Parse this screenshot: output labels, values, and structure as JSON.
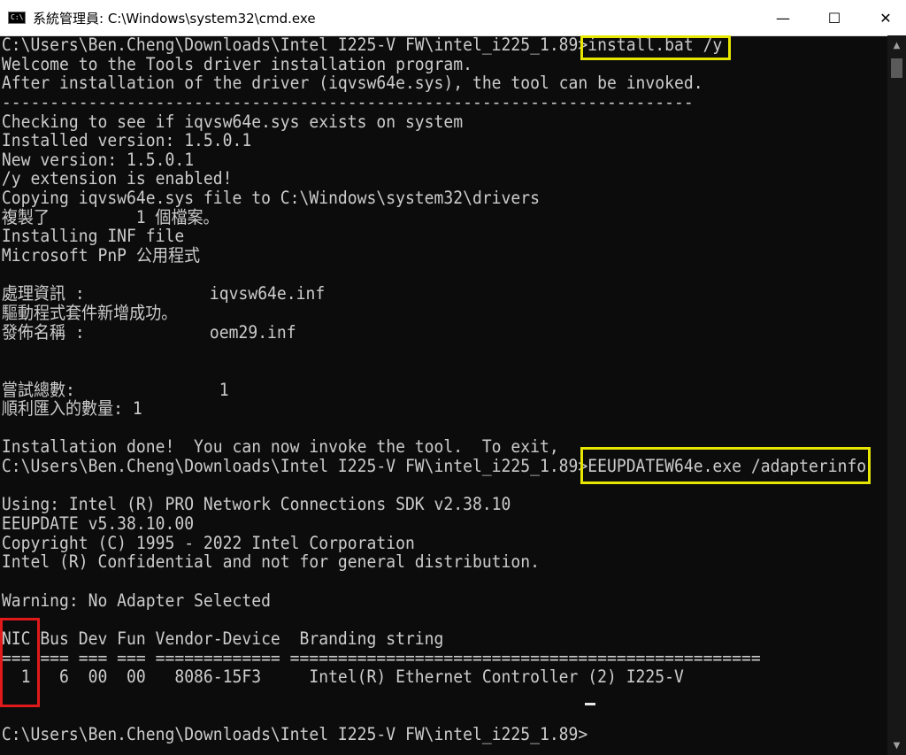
{
  "window": {
    "title": "系統管理員: C:\\Windows\\system32\\cmd.exe",
    "icon_text": "C:\\.",
    "minimize": "—",
    "maximize": "☐",
    "close": "✕"
  },
  "terminal": {
    "lines": [
      "C:\\Users\\Ben.Cheng\\Downloads\\Intel I225-V FW\\intel_i225_1.89>install.bat /y",
      "Welcome to the Tools driver installation program.",
      "After installation of the driver (iqvsw64e.sys), the tool can be invoked.",
      "------------------------------------------------------------------------",
      "Checking to see if iqvsw64e.sys exists on system",
      "Installed version: 1.5.0.1",
      "New version: 1.5.0.1",
      "/y extension is enabled!",
      "Copying iqvsw64e.sys file to C:\\Windows\\system32\\drivers",
      "複製了         1 個檔案。",
      "Installing INF file",
      "Microsoft PnP 公用程式",
      "",
      "處理資訊 :             iqvsw64e.inf",
      "驅動程式套件新增成功。",
      "發佈名稱 :             oem29.inf",
      "",
      "",
      "嘗試總數:               1",
      "順利匯入的數量: 1",
      "",
      "Installation done!  You can now invoke the tool.  To exit,",
      "C:\\Users\\Ben.Cheng\\Downloads\\Intel I225-V FW\\intel_i225_1.89>EEUPDATEW64e.exe /adapterinfo",
      "",
      "Using: Intel (R) PRO Network Connections SDK v2.38.10",
      "EEUPDATE v5.38.10.00",
      "Copyright (C) 1995 - 2022 Intel Corporation",
      "Intel (R) Confidential and not for general distribution.",
      "",
      "Warning: No Adapter Selected",
      "",
      "NIC Bus Dev Fun Vendor-Device  Branding string",
      "=== === === === ============= =================================================",
      "  1   6  00  00   8086-15F3     Intel(R) Ethernet Controller (2) I225-V",
      "",
      "",
      "C:\\Users\\Ben.Cheng\\Downloads\\Intel I225-V FW\\intel_i225_1.89>"
    ]
  },
  "colors": {
    "background": "#0c0c0c",
    "text": "#cccccc",
    "highlight_yellow": "#e6e600",
    "highlight_red": "#e0191b"
  }
}
